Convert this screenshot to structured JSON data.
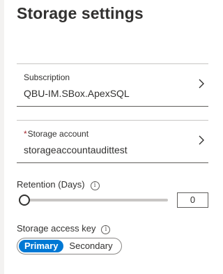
{
  "page": {
    "title": "Storage settings"
  },
  "subscription": {
    "label": "Subscription",
    "value": "QBU-IM.SBox.ApexSQL"
  },
  "storage_account": {
    "required_marker": "*",
    "label": "Storage account",
    "value": "storageaccountaudittest"
  },
  "retention": {
    "label": "Retention (Days)",
    "value": "0",
    "slider_fraction": 0
  },
  "access_key": {
    "label": "Storage access key",
    "options": [
      {
        "label": "Primary",
        "selected": true
      },
      {
        "label": "Secondary",
        "selected": false
      }
    ]
  },
  "icons": {
    "info": "info-icon",
    "chevron": "chevron-right-icon"
  },
  "colors": {
    "accent": "#0078d4",
    "required": "#a4262c",
    "text": "#323130"
  }
}
